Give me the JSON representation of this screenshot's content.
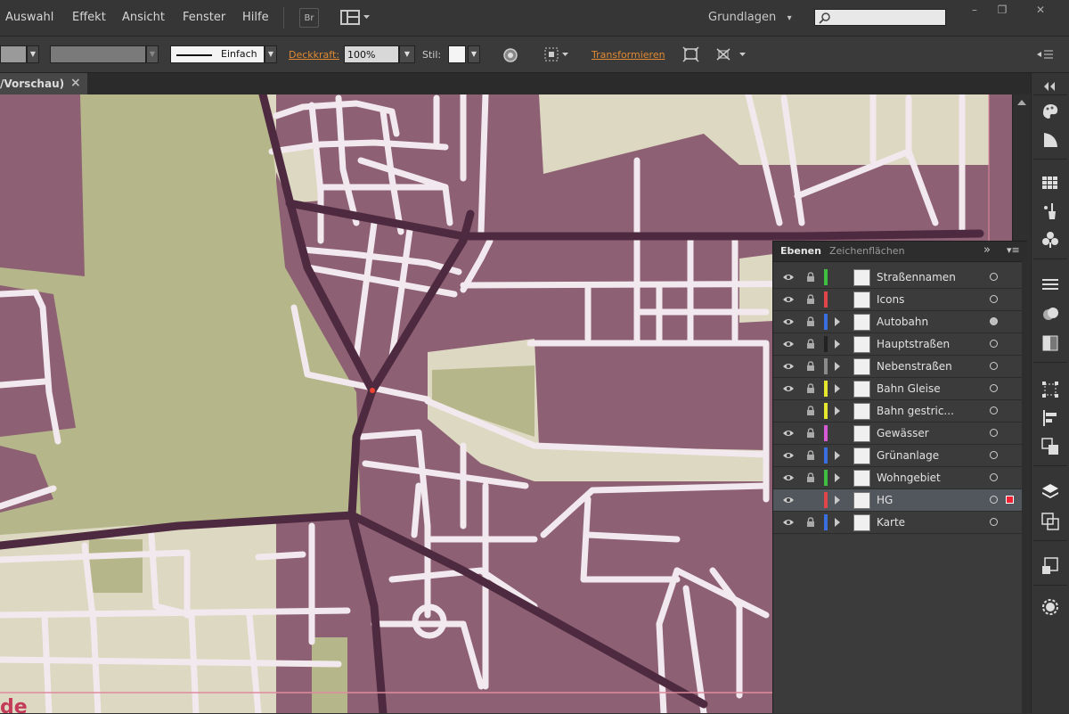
{
  "menu": [
    "Auswahl",
    "Effekt",
    "Ansicht",
    "Fenster",
    "Hilfe"
  ],
  "toolbar_icons": {
    "bridge_label": "Br",
    "arrange": "arrange-documents-icon"
  },
  "workspace": {
    "label": "Grundlagen",
    "caret": "▾"
  },
  "search": {
    "placeholder": "",
    "icon": "search-icon"
  },
  "window_controls": [
    "–",
    "❐",
    "✕"
  ],
  "control_bar": {
    "stroke_style": "Einfach",
    "opacity_label": "Deckkraft:",
    "opacity_value": "100%",
    "style_label": "Stil:",
    "transform_label": "Transformieren",
    "dropdown_arrow": "▼",
    "menu_icon": "panel-menu-icon"
  },
  "document_tab": {
    "title": "/Vorschau)",
    "close": "×"
  },
  "canvas_partial_text": "de",
  "layers_panel": {
    "tabs": [
      "Ebenen",
      "Zeichenflächen"
    ],
    "collapse_glyph": "»",
    "menu_glyph": "▾≡",
    "selected_layer": "HG",
    "layers": [
      {
        "name": "Straßennamen",
        "color": "#3fbf3f",
        "visible": true,
        "expandable": false,
        "target_filled": false
      },
      {
        "name": "Icons",
        "color": "#e0454a",
        "visible": true,
        "expandable": false,
        "target_filled": false
      },
      {
        "name": "Autobahn",
        "color": "#3a6fe0",
        "visible": true,
        "expandable": true,
        "target_filled": true
      },
      {
        "name": "Hauptstraßen",
        "color": "#222222",
        "visible": true,
        "expandable": true,
        "target_filled": false
      },
      {
        "name": "Nebenstraßen",
        "color": "#8a8a8a",
        "visible": true,
        "expandable": true,
        "target_filled": false
      },
      {
        "name": "Bahn Gleise",
        "color": "#e6e62e",
        "visible": true,
        "expandable": true,
        "target_filled": false
      },
      {
        "name": "Bahn gestric...",
        "color": "#e6e62e",
        "visible": false,
        "expandable": true,
        "target_filled": false
      },
      {
        "name": "Gewässer",
        "color": "#d65ad6",
        "visible": true,
        "expandable": false,
        "target_filled": false
      },
      {
        "name": "Grünanlage",
        "color": "#3a6fe0",
        "visible": true,
        "expandable": true,
        "target_filled": false
      },
      {
        "name": "Wohngebiet",
        "color": "#3fbf3f",
        "visible": true,
        "expandable": true,
        "target_filled": false
      },
      {
        "name": "HG",
        "color": "#e0454a",
        "visible": true,
        "expandable": true,
        "target_filled": false
      },
      {
        "name": "Karte",
        "color": "#3a6fe0",
        "visible": true,
        "expandable": true,
        "target_filled": false
      }
    ]
  },
  "right_dock_icons": [
    "collapse-arrows-icon",
    "color-icon",
    "color-guide-icon",
    "swatches-icon",
    "brushes-icon",
    "symbols-icon",
    "stroke-icon",
    "gradient-icon",
    "transparency-icon",
    "transform-icon",
    "align-icon",
    "pathfinder-icon",
    "layers-icon",
    "artboards-icon",
    "links-icon",
    "appearance-icon"
  ],
  "colors": {
    "block": "#8d6073",
    "road": "#f2e9ee",
    "main_road": "#4e2a40",
    "green": "#b5b78a",
    "beige": "#ddd8c2",
    "accent": "#e08a33"
  }
}
